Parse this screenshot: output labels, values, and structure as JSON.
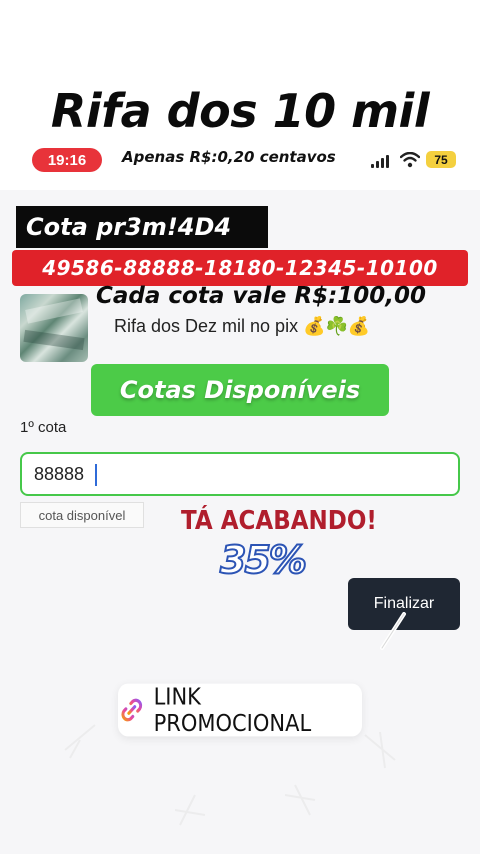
{
  "header": {
    "title": "Rifa dos 10 mil",
    "subtitle": "Apenas R$:0,20 centavos"
  },
  "status_bar": {
    "time": "19:16",
    "battery": "75",
    "icons": [
      "signal-icon",
      "wifi-icon",
      "battery-icon"
    ]
  },
  "raffle": {
    "cota_title": "Cota pr3m!4D4",
    "cota_numbers": "49586-88888-18180-12345-10100",
    "cota_value": "Cada cota vale R$:100,00",
    "description": "Rifa dos Dez mil no pix 💰☘️💰",
    "button_label": "Cotas Disponíveis"
  },
  "form": {
    "field_label": "1º cota",
    "input_value": "88888",
    "status_tag": "cota disponível"
  },
  "promo": {
    "urgency": "TÁ ACABANDO!",
    "percent": "35%",
    "finalize_label": "Finalizar",
    "link_label": "LINK PROMOCIONAL"
  },
  "colors": {
    "brand_red": "#e02229",
    "brand_green": "#4ccb48",
    "dark_button": "#1f2733",
    "urgency_red": "#b01e2d"
  }
}
